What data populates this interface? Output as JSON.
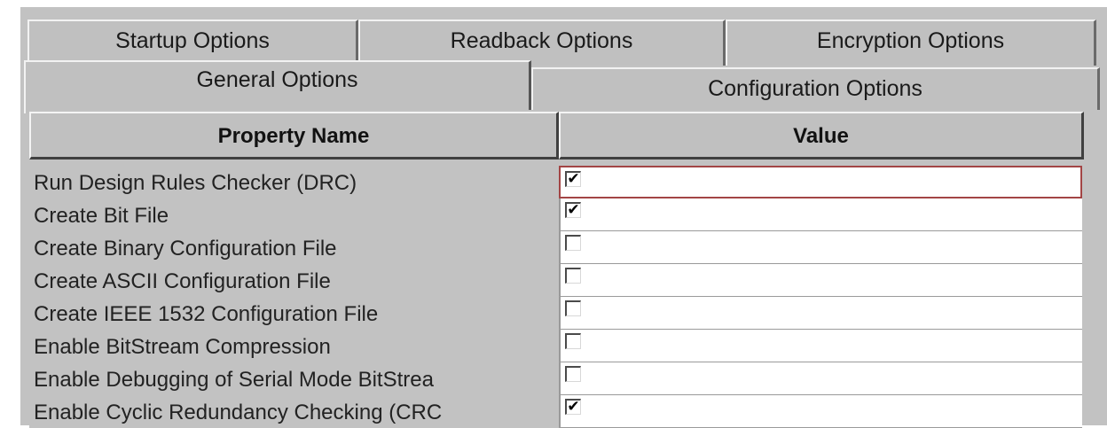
{
  "tabs": {
    "row1": [
      "Startup Options",
      "Readback Options",
      "Encryption Options"
    ],
    "row2": [
      "General Options",
      "Configuration Options"
    ],
    "active": "General Options"
  },
  "table": {
    "headers": {
      "name": "Property Name",
      "value": "Value"
    },
    "rows": [
      {
        "name": "Run Design Rules Checker (DRC)",
        "checked": true
      },
      {
        "name": "Create Bit File",
        "checked": true
      },
      {
        "name": "Create Binary Configuration File",
        "checked": false
      },
      {
        "name": "Create ASCII Configuration File",
        "checked": false
      },
      {
        "name": "Create IEEE 1532 Configuration File",
        "checked": false
      },
      {
        "name": "Enable BitStream Compression",
        "checked": false
      },
      {
        "name": "Enable Debugging of Serial Mode BitStrea",
        "checked": false
      },
      {
        "name": "Enable Cyclic Redundancy Checking (CRC",
        "checked": true
      }
    ]
  },
  "icons": {
    "checkmark": "check-icon"
  }
}
